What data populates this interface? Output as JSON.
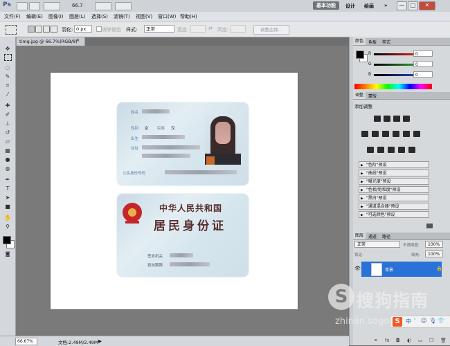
{
  "app": {
    "logo": "Ps",
    "zoom": "66.7",
    "workspaces": [
      "基本功能",
      "设计",
      "绘画"
    ],
    "window_buttons": {
      "minimize": "—",
      "restore": "□",
      "close": "✕"
    }
  },
  "menu": {
    "items": [
      "文件(F)",
      "编辑(E)",
      "图像(I)",
      "图层(L)",
      "选择(S)",
      "滤镜(T)",
      "视图(V)",
      "窗口(W)",
      "帮助(H)"
    ]
  },
  "options": {
    "feather_label": "羽化:",
    "feather_value": "0 px",
    "antialias_label": "消除锯齿",
    "style_label": "样式:",
    "style_value": "正常",
    "width_label": "宽度:",
    "height_label": "高度:",
    "refine_edge": "调整边缘..."
  },
  "document": {
    "tab_title": "timg.jpg @ 66.7%(RGB/8)",
    "front": {
      "labels": [
        "姓名",
        "性别",
        "出生",
        "住址",
        "公民身份号码"
      ],
      "gender_label": "性别",
      "gender_value": "女",
      "ethnicity_label": "民族",
      "ethnicity_value": "汉"
    },
    "back": {
      "line1": "中华人民共和国",
      "line2": "居民身份证",
      "issuer_label": "签发机关",
      "validity_label": "有效期限"
    }
  },
  "panels": {
    "color": {
      "tabs": [
        "颜色",
        "色板",
        "样式"
      ],
      "r_label": "R",
      "g_label": "G",
      "b_label": "B",
      "r": "0",
      "g": "0",
      "b": "0",
      "colors": {
        "r": "#e0281c",
        "g": "#2fa52f",
        "b": "#2d46c8"
      }
    },
    "adjustments": {
      "tabs": [
        "调整",
        "蒙版"
      ],
      "title": "添加调整",
      "presets": [
        "\"色阶\"预设",
        "\"曲线\"预设",
        "\"曝光度\"预设",
        "\"色相/饱和度\"预设",
        "\"黑白\"预设",
        "\"通道混合器\"预设",
        "\"可选颜色\"预设"
      ]
    },
    "layers": {
      "tabs": [
        "图层",
        "通道",
        "路径"
      ],
      "blend_mode": "正常",
      "opacity_label": "不透明度:",
      "opacity": "100%",
      "lock_label": "锁定:",
      "fill_label": "填充:",
      "fill": "100%",
      "layer_name": "背景",
      "accent": "#2a72d8"
    }
  },
  "status": {
    "zoom": "66.67%",
    "doc_size": "文档:2.49M/2.49M"
  },
  "watermark": {
    "logo": "S",
    "text": "搜狗指南",
    "url": "zhinan.sogo",
    "ime_label": "中"
  }
}
